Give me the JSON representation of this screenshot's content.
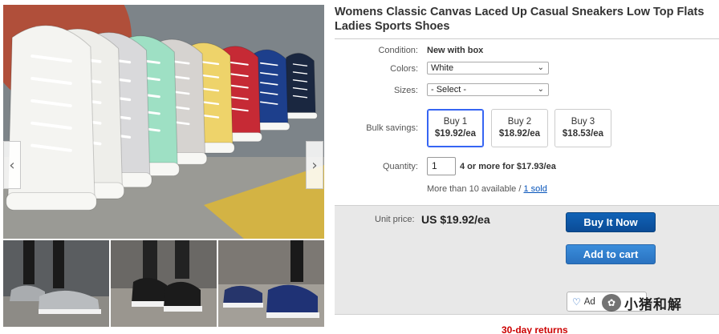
{
  "product": {
    "title": "Womens Classic Canvas Laced Up Casual Sneakers Low Top Flats Ladies Sports Shoes"
  },
  "gallery": {
    "prev_icon": "chevron-left-icon",
    "next_icon": "chevron-right-icon",
    "prev_glyph": "‹",
    "next_glyph": "›",
    "shoe_colors": [
      "#f4f4f1",
      "#eeeeea",
      "#d9d9db",
      "#9ee0c4",
      "#d6d3d0",
      "#eed36a",
      "#c62a35",
      "#1d3f8c",
      "#1a2740"
    ]
  },
  "condition": {
    "label": "Condition:",
    "value": "New with box"
  },
  "colors": {
    "label": "Colors:",
    "value": "White"
  },
  "sizes": {
    "label": "Sizes:",
    "value": "- Select -"
  },
  "bulk": {
    "label": "Bulk savings:",
    "options": [
      {
        "qty": "Buy 1",
        "price": "$19.92/ea",
        "selected": true
      },
      {
        "qty": "Buy 2",
        "price": "$18.92/ea",
        "selected": false
      },
      {
        "qty": "Buy 3",
        "price": "$18.53/ea",
        "selected": false
      }
    ]
  },
  "quantity": {
    "label": "Quantity:",
    "value": "1",
    "bulk_note": "4 or more for $17.93/ea",
    "availability": "More than 10 available / ",
    "sold": "1 sold"
  },
  "purchase": {
    "unit_label": "Unit price:",
    "unit_price": "US $19.92/ea",
    "buy_now": "Buy It Now",
    "add_to_cart": "Add to cart",
    "watch_partial": "Ad"
  },
  "watermark": {
    "logo": "✿",
    "text": "小猪和解"
  },
  "returns": {
    "text": "30-day returns"
  },
  "colors_theme": {
    "accent": "#0654ba",
    "buy": "#0b4c96",
    "cart": "#2a72c0",
    "selected_border": "#3665f3"
  }
}
